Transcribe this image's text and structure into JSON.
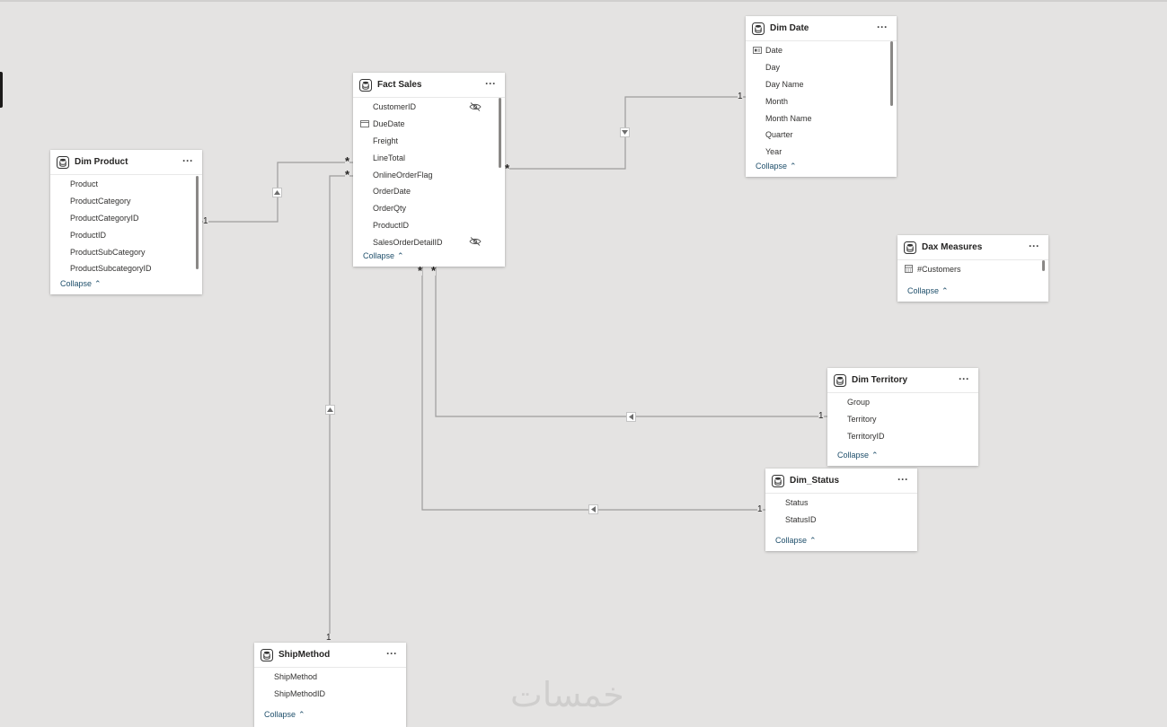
{
  "canvas": {
    "background": "#e4e3e2",
    "line_color": "#9d9d9d",
    "link_color": "#1f4f6b"
  },
  "tables": {
    "fact_sales": {
      "title": "Fact Sales",
      "fields": [
        "CustomerID",
        "DueDate",
        "Freight",
        "LineTotal",
        "OnlineOrderFlag",
        "OrderDate",
        "OrderQty",
        "ProductID",
        "SalesOrderDetailID"
      ],
      "collapse": "Collapse"
    },
    "dim_product": {
      "title": "Dim Product",
      "fields": [
        "Product",
        "ProductCategory",
        "ProductCategoryID",
        "ProductID",
        "ProductSubCategory",
        "ProductSubcategoryID"
      ],
      "collapse": "Collapse"
    },
    "dim_date": {
      "title": "Dim Date",
      "fields": [
        "Date",
        "Day",
        "Day Name",
        "Month",
        "Month Name",
        "Quarter",
        "Year"
      ],
      "collapse": "Collapse"
    },
    "dax_measures": {
      "title": "Dax Measures",
      "fields": [
        "#Customers"
      ],
      "collapse": "Collapse"
    },
    "dim_territory": {
      "title": "Dim Territory",
      "fields": [
        "Group",
        "Territory",
        "TerritoryID"
      ],
      "collapse": "Collapse"
    },
    "dim_status": {
      "title": "Dim_Status",
      "fields": [
        "Status",
        "StatusID"
      ],
      "collapse": "Collapse"
    },
    "shipmethod": {
      "title": "ShipMethod",
      "fields": [
        "ShipMethod",
        "ShipMethodID"
      ],
      "collapse": "Collapse"
    }
  },
  "relationships": [
    {
      "from": "Dim Product",
      "to": "Fact Sales",
      "one_side": "1",
      "many_side": "*",
      "filter_direction": "single"
    },
    {
      "from": "ShipMethod",
      "to": "Fact Sales",
      "one_side": "1",
      "many_side": "*",
      "filter_direction": "single"
    },
    {
      "from": "Dim Date",
      "to": "Fact Sales",
      "one_side": "1",
      "many_side": "*",
      "filter_direction": "single"
    },
    {
      "from": "Dim Territory",
      "to": "Fact Sales",
      "one_side": "1",
      "many_side": "*",
      "filter_direction": "single"
    },
    {
      "from": "Dim_Status",
      "to": "Fact Sales",
      "one_side": "1",
      "many_side": "*",
      "filter_direction": "single"
    }
  ],
  "cardinality": {
    "one": "1",
    "many": "*"
  },
  "watermark": "خمسات"
}
